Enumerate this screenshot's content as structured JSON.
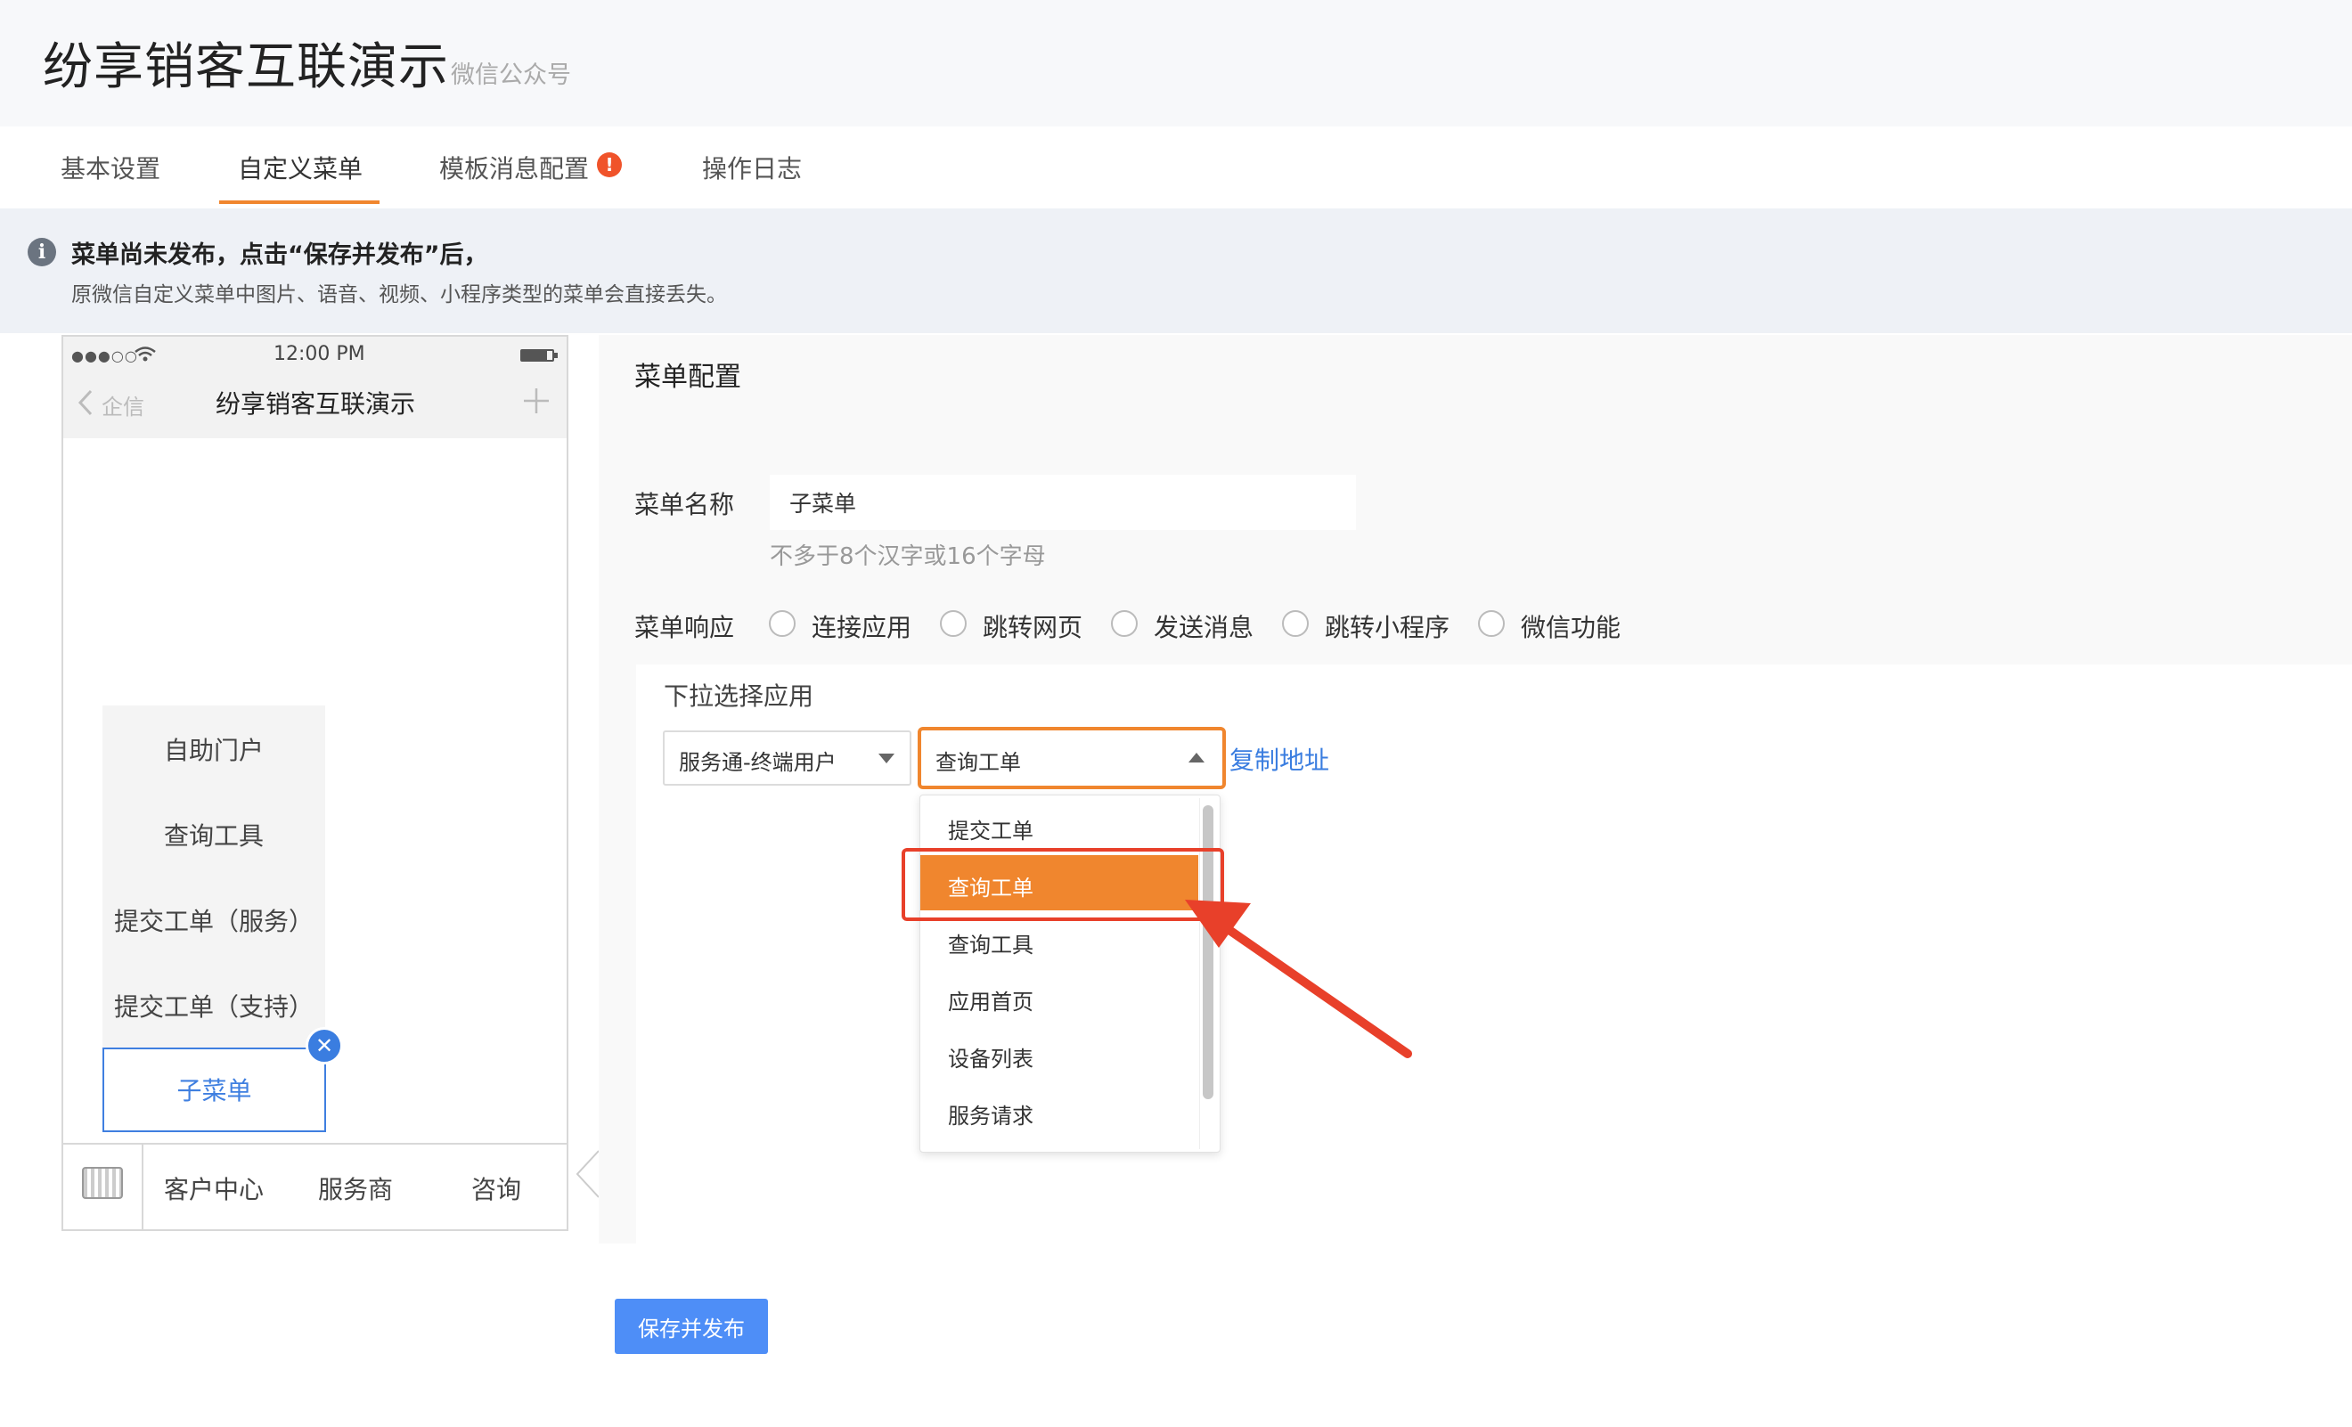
{
  "header": {
    "title": "纷享销客互联演示",
    "subtitle": "微信公众号"
  },
  "tabs": [
    {
      "label": "基本设置"
    },
    {
      "label": "自定义菜单"
    },
    {
      "label": "模板消息配置",
      "badge": "!"
    },
    {
      "label": "操作日志"
    }
  ],
  "notice": {
    "icon": "info-icon",
    "title": "菜单尚未发布，点击“保存并发布”后，",
    "description": "原微信自定义菜单中图片、语音、视频、小程序类型的菜单会直接丢失。"
  },
  "phone": {
    "status_time": "12:00 PM",
    "back_label": "企信",
    "title": "纷享销客互联演示",
    "submenu_items": [
      "自助门户",
      "查询工具",
      "提交工单（服务）",
      "提交工单（支持）"
    ],
    "selected_submenu": "子菜单",
    "tabbar": [
      "客户中心",
      "服务商",
      "咨询"
    ]
  },
  "config": {
    "title": "菜单配置",
    "name_label": "菜单名称",
    "name_value": "子菜单",
    "name_hint": "不多于8个汉字或16个字母",
    "response_label": "菜单响应",
    "response_options": [
      "连接应用",
      "跳转网页",
      "发送消息",
      "跳转小程序",
      "微信功能"
    ],
    "app_panel_title": "下拉选择应用",
    "select1_value": "服务通-终端用户",
    "select2_value": "查询工单",
    "copy_link": "复制地址",
    "dropdown_options": [
      "提交工单",
      "查询工单",
      "查询工具",
      "应用首页",
      "设备列表",
      "服务请求"
    ],
    "dropdown_highlighted": "查询工单"
  },
  "save_button": "保存并发布",
  "colors": {
    "accent": "#f0862e",
    "link": "#3a7de0",
    "annotation": "#e8402a",
    "primary_button": "#4e8ef7"
  }
}
